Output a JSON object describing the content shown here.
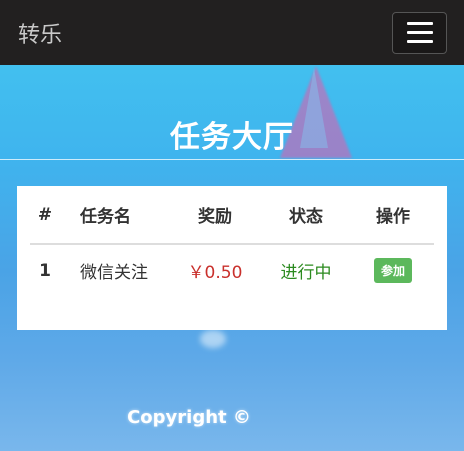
{
  "navbar": {
    "brand": "转乐",
    "menu_icon": "hamburger-menu-icon"
  },
  "page": {
    "title": "任务大厅"
  },
  "task_table": {
    "headers": {
      "index": "#",
      "name": "任务名",
      "reward": "奖励",
      "status": "状态",
      "action": "操作"
    },
    "rows": [
      {
        "index": "1",
        "name": "微信关注",
        "reward": "￥0.50",
        "status": "进行中",
        "action_label": "参加"
      }
    ]
  },
  "footer": {
    "copyright": "Copyright ©"
  },
  "colors": {
    "navbar_bg": "#222020",
    "reward_color": "#c9302c",
    "status_color": "#2b8a1f",
    "join_button": "#5cb85c"
  }
}
